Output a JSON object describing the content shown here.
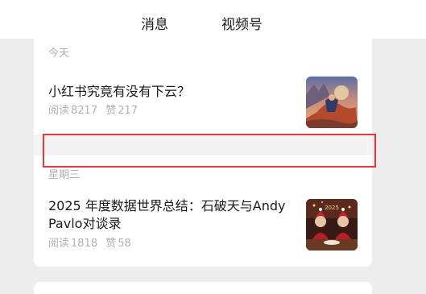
{
  "tabs": {
    "messages": "消息",
    "channels": "视频号"
  },
  "sections": [
    {
      "label": "今天",
      "article": {
        "title": "小红书究竟有没有下云？",
        "reads_label": "阅读",
        "reads": "8217",
        "likes_label": "赞",
        "likes": "217",
        "thumbnail_icon": "fantasy-illustration-thumbnail"
      }
    },
    {
      "label": "星期三",
      "article": {
        "title": "2025 年度数据世界总结：石破天与Andy Pavlo对谈录",
        "reads_label": "阅读",
        "reads": "1818",
        "likes_label": "赞",
        "likes": "58",
        "thumbnail_icon": "christmas-dinner-thumbnail",
        "thumbnail_text": "2025"
      }
    }
  ],
  "colors": {
    "highlight": "#e8383d",
    "background": "#ededed",
    "meta_text": "#b2b2b2"
  }
}
